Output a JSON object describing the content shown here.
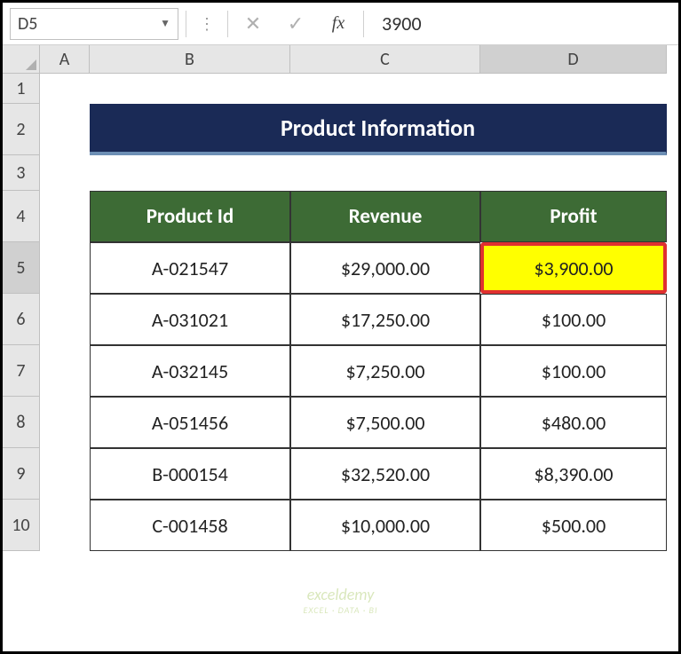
{
  "formula_bar": {
    "name_box": "D5",
    "fx_label": "fx",
    "value": "3900"
  },
  "columns": [
    "A",
    "B",
    "C",
    "D"
  ],
  "rows": [
    "1",
    "2",
    "3",
    "4",
    "5",
    "6",
    "7",
    "8",
    "9",
    "10"
  ],
  "title": "Product Information",
  "headers": {
    "product_id": "Product Id",
    "revenue": "Revenue",
    "profit": "Profit"
  },
  "data": [
    {
      "id": "A-021547",
      "revenue": "$29,000.00",
      "profit": "$3,900.00"
    },
    {
      "id": "A-031021",
      "revenue": "$17,250.00",
      "profit": "$100.00"
    },
    {
      "id": "A-032145",
      "revenue": "$7,250.00",
      "profit": "$100.00"
    },
    {
      "id": "A-051456",
      "revenue": "$7,500.00",
      "profit": "$480.00"
    },
    {
      "id": "B-000154",
      "revenue": "$32,520.00",
      "profit": "$8,390.00"
    },
    {
      "id": "C-001458",
      "revenue": "$10,000.00",
      "profit": "$500.00"
    }
  ],
  "active": {
    "col": "D",
    "row": "5"
  },
  "watermark": {
    "main": "exceldemy",
    "sub": "EXCEL · DATA · BI"
  }
}
